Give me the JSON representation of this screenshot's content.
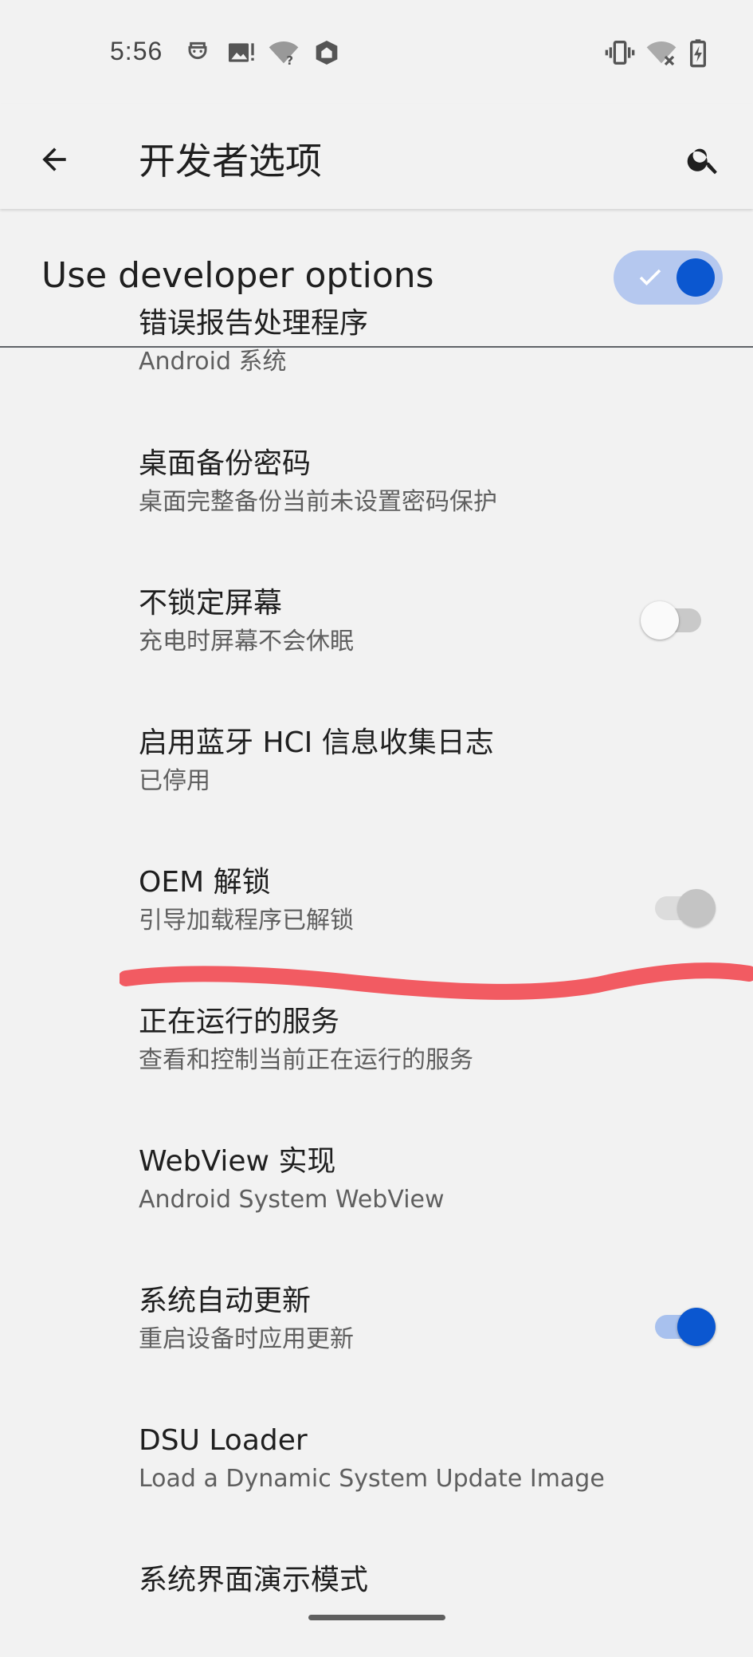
{
  "status_bar": {
    "time": "5:56",
    "left_icons": [
      "face-recognition-icon",
      "image-alert-icon",
      "wifi-question-icon",
      "vpn-shield-icon"
    ],
    "right_icons": [
      "vibrate-icon",
      "wifi-off-icon",
      "battery-charging-icon"
    ]
  },
  "toolbar": {
    "back_icon": "arrow-back-icon",
    "title": "开发者选项",
    "search_icon": "search-icon"
  },
  "master_switch": {
    "label": "Use developer options",
    "state": "on"
  },
  "settings": [
    {
      "title": "错误报告处理程序",
      "summary": "Android 系统",
      "toggle": null
    },
    {
      "title": "桌面备份密码",
      "summary": "桌面完整备份当前未设置密码保护",
      "toggle": null
    },
    {
      "title": "不锁定屏幕",
      "summary": "充电时屏幕不会休眠",
      "toggle": "off"
    },
    {
      "title": "启用蓝牙 HCI 信息收集日志",
      "summary": "已停用",
      "toggle": null
    },
    {
      "title": "OEM 解锁",
      "summary": "引导加载程序已解锁",
      "toggle": "on-disabled"
    },
    {
      "title": "正在运行的服务",
      "summary": "查看和控制当前正在运行的服务",
      "toggle": null
    },
    {
      "title": "WebView 实现",
      "summary": "Android System WebView",
      "toggle": null
    },
    {
      "title": "系统自动更新",
      "summary": "重启设备时应用更新",
      "toggle": "on"
    },
    {
      "title": "DSU Loader",
      "summary": "Load a Dynamic System Update Image",
      "toggle": null
    },
    {
      "title": "系统界面演示模式",
      "summary": "",
      "toggle": null
    }
  ],
  "colors": {
    "background": "#f2f2f2",
    "accent": "#0b57d0",
    "annotation": "#f25b62"
  }
}
